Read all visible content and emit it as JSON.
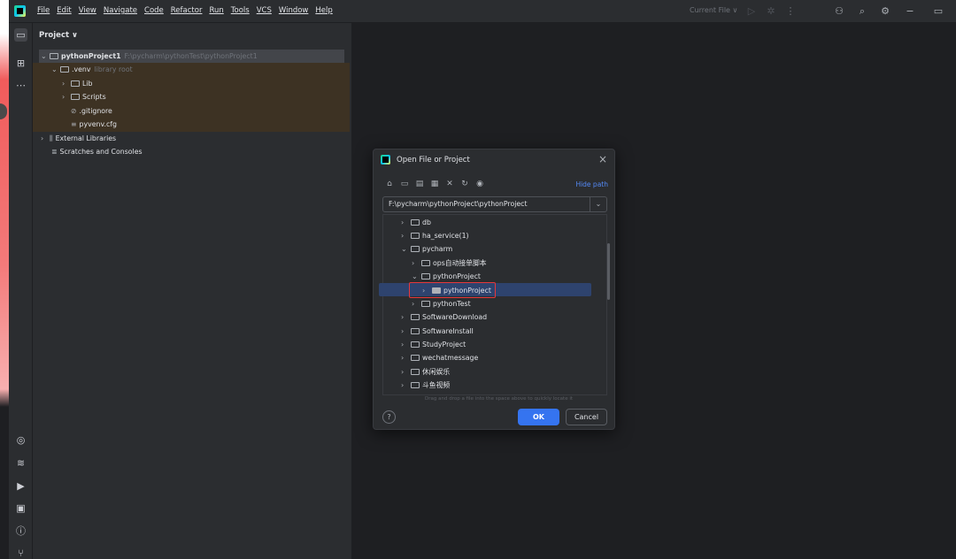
{
  "menu": [
    "File",
    "Edit",
    "View",
    "Navigate",
    "Code",
    "Refactor",
    "Run",
    "Tools",
    "VCS",
    "Window",
    "Help"
  ],
  "titlebar": {
    "run_config": "Current File ∨"
  },
  "project": {
    "header": "Project ∨",
    "tree": [
      {
        "label": "pythonProject1",
        "hint": "F:\\pycharm\\pythonTest\\pythonProject1"
      },
      {
        "label": ".venv",
        "hint": "library root"
      },
      {
        "label": "Lib"
      },
      {
        "label": "Scripts"
      },
      {
        "label": ".gitignore"
      },
      {
        "label": "pyvenv.cfg"
      },
      {
        "label": "External Libraries"
      },
      {
        "label": "Scratches and Consoles"
      }
    ]
  },
  "dialog": {
    "title": "Open File or Project",
    "hide_path": "Hide path",
    "path": "F:\\pycharm\\pythonProject\\pythonProject",
    "tree": [
      {
        "label": "db"
      },
      {
        "label": "ha_service(1)"
      },
      {
        "label": "pycharm"
      },
      {
        "label": "ops自动接单脚本"
      },
      {
        "label": "pythonProject"
      },
      {
        "label": "pythonProject"
      },
      {
        "label": "pythonTest"
      },
      {
        "label": "SoftwareDownload"
      },
      {
        "label": "SoftwareInstall"
      },
      {
        "label": "StudyProject"
      },
      {
        "label": "wechatmessage"
      },
      {
        "label": "休闲娱乐"
      },
      {
        "label": "斗鱼视频"
      }
    ],
    "drop_hint": "Drag and drop a file into the space above to quickly locate it",
    "ok": "OK",
    "cancel": "Cancel"
  },
  "colors": {
    "accent": "#3574f0",
    "selection": "#2e436e",
    "highlight_box": "#e5383b"
  }
}
